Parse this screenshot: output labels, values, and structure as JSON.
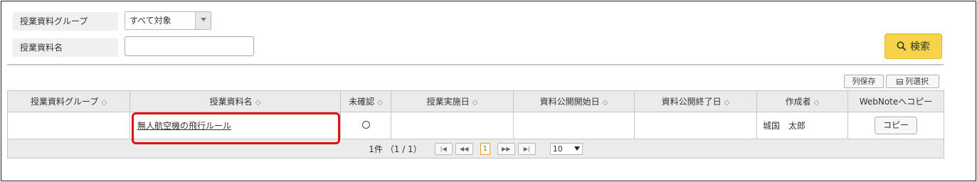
{
  "filters": {
    "group_label": "授業資料グループ",
    "group_selected": "すべて対象",
    "name_label": "授業資料名",
    "name_value": "",
    "search_label": "検索"
  },
  "toolbar": {
    "save_columns_label": "列保存",
    "select_columns_label": "列選択"
  },
  "table": {
    "headers": [
      "授業資料グループ",
      "授業資料名",
      "未確認",
      "授業実施日",
      "資料公開開始日",
      "資料公開終了日",
      "作成者",
      "WebNoteへコピー"
    ],
    "rows": [
      {
        "group": "",
        "name": "無人航空機の飛行ルール",
        "unconfirmed": "○",
        "class_date": "",
        "publish_start": "",
        "publish_end": "",
        "author": "城国　太郎",
        "copy_label": "コピー"
      }
    ]
  },
  "pager": {
    "summary": "1件 （1 / 1）",
    "current_page": "1",
    "page_size": "10",
    "first_label": "|◀",
    "prev_label": "◀◀",
    "next_label": "▶▶",
    "last_label": "▶|"
  },
  "colors": {
    "search_button": "#f7d34a",
    "highlight": "#e01010",
    "header_bg": "#ebebeb"
  }
}
